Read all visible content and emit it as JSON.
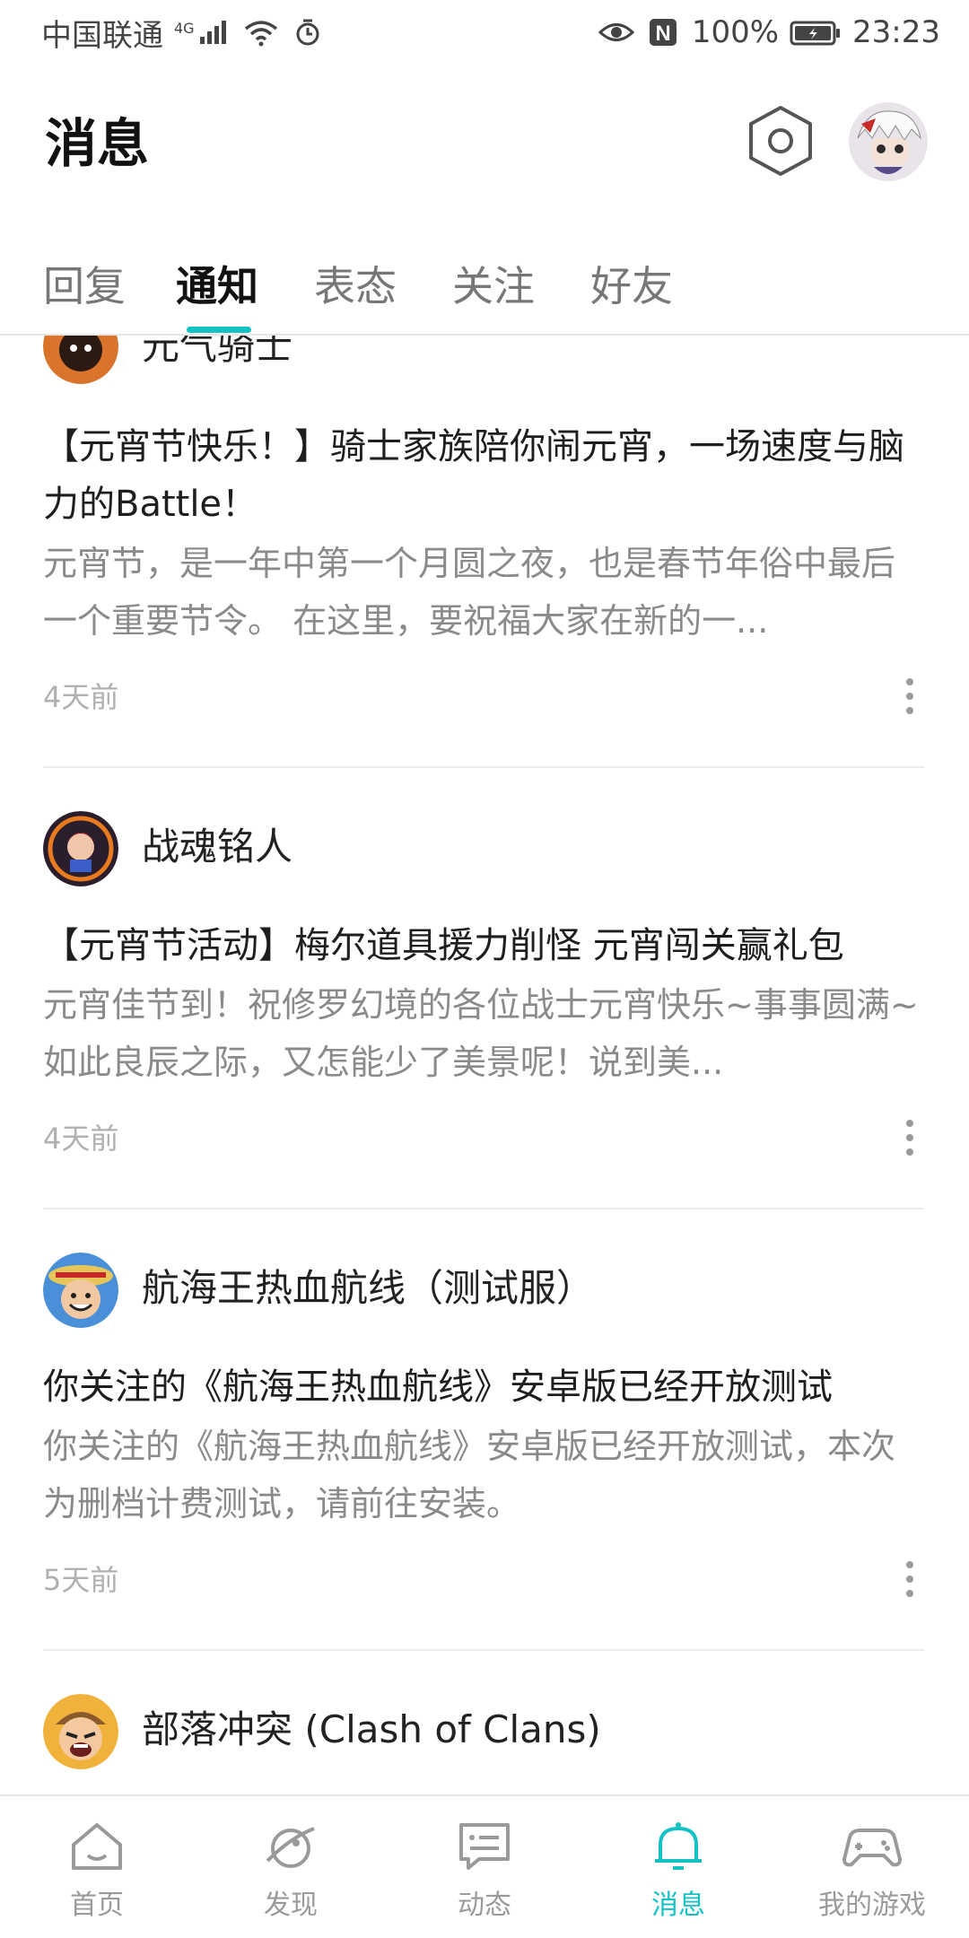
{
  "status_bar": {
    "carrier": "中国联通",
    "network": "4G",
    "battery": "100%",
    "time": "23:23",
    "nfc": "N",
    "icons": [
      "signal-icon",
      "wifi-icon",
      "alarm-icon",
      "eye-icon",
      "nfc-icon",
      "battery-icon"
    ]
  },
  "header": {
    "title": "消息",
    "settings_icon": "settings-hexagon-icon",
    "avatar_icon": "user-avatar"
  },
  "tabs": [
    {
      "label": "回复",
      "active": false
    },
    {
      "label": "通知",
      "active": true
    },
    {
      "label": "表态",
      "active": false
    },
    {
      "label": "关注",
      "active": false
    },
    {
      "label": "好友",
      "active": false
    }
  ],
  "accent_color": "#14c2c6",
  "notifications": [
    {
      "name": "元气骑士",
      "title": "【元宵节快乐！】骑士家族陪你闹元宵，一场速度与脑力的Battle！",
      "body": "元宵节，是一年中第一个月圆之夜，也是春节年俗中最后一个重要节令。 在这里，要祝福大家在新的一...",
      "time": "4天前",
      "avatar_icon": "soul-knight-avatar"
    },
    {
      "name": "战魂铭人",
      "title": "【元宵节活动】梅尔道具援力削怪 元宵闯关赢礼包",
      "body": "元宵佳节到！祝修罗幻境的各位战士元宵快乐~事事圆满~ 如此良辰之际，又怎能少了美景呢！说到美...",
      "time": "4天前",
      "avatar_icon": "otherworld-legends-avatar"
    },
    {
      "name": "航海王热血航线（测试服）",
      "title": "你关注的《航海王热血航线》安卓版已经开放测试",
      "body": "你关注的《航海王热血航线》安卓版已经开放测试，本次为删档计费测试，请前往安装。",
      "time": "5天前",
      "avatar_icon": "one-piece-avatar"
    },
    {
      "name": "部落冲突 (Clash of Clans)",
      "avatar_icon": "clash-of-clans-avatar"
    }
  ],
  "bottom_nav": [
    {
      "label": "首页",
      "icon": "home-icon",
      "active": false
    },
    {
      "label": "发现",
      "icon": "discover-planet-icon",
      "active": false
    },
    {
      "label": "动态",
      "icon": "feed-chat-icon",
      "active": false
    },
    {
      "label": "消息",
      "icon": "bell-icon",
      "active": true
    },
    {
      "label": "我的游戏",
      "icon": "gamepad-icon",
      "active": false
    }
  ]
}
